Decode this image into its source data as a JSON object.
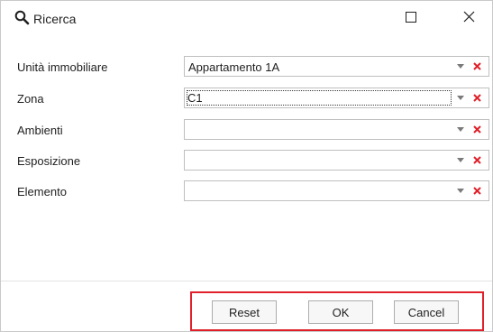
{
  "window": {
    "title": "Ricerca"
  },
  "fields": [
    {
      "label": "Unità immobiliare",
      "value": "Appartamento 1A"
    },
    {
      "label": "Zona",
      "value": "C1"
    },
    {
      "label": "Ambienti",
      "value": ""
    },
    {
      "label": "Esposizione",
      "value": ""
    },
    {
      "label": "Elemento",
      "value": ""
    }
  ],
  "buttons": {
    "reset": "Reset",
    "ok": "OK",
    "cancel": "Cancel"
  },
  "colors": {
    "clear_icon": "#e0202a",
    "highlight_border": "#e0202a"
  },
  "icons": {
    "title": "search-icon",
    "maximize": "maximize-icon",
    "close": "close-icon",
    "dropdown": "chevron-down-icon",
    "clear": "clear-x-icon"
  }
}
